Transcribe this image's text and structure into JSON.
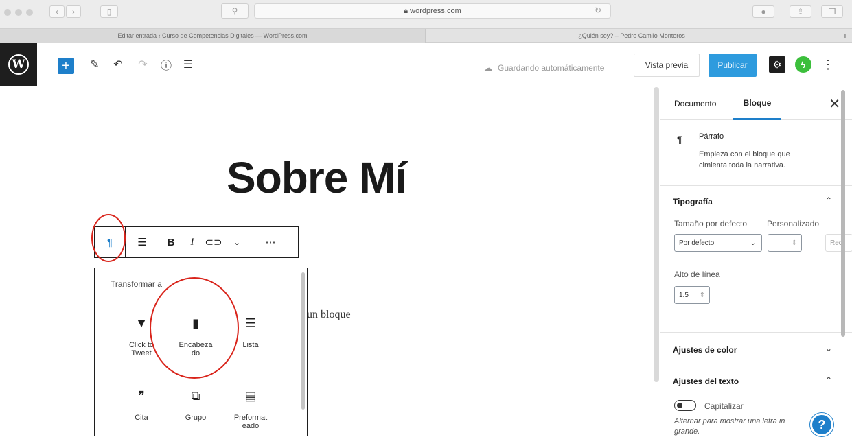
{
  "browser": {
    "url": "wordpress.com",
    "tabs": [
      {
        "label": "Editar entrada ‹ Curso de Competencias Digitales — WordPress.com"
      },
      {
        "label": "¿Quién soy? – Pedro Camilo Monteros"
      }
    ],
    "new_tab": "+"
  },
  "toolbar": {
    "wp_logo": "W",
    "add_label": "+",
    "saving_text": "Guardando automáticamente",
    "preview_label": "Vista previa",
    "publish_label": "Publicar",
    "kebab": "⋮"
  },
  "editor": {
    "title": "Sobre Mí",
    "paragraph_fragment": "un bloque",
    "block_toolbar": {
      "paragraph_icon": "¶",
      "bold": "B",
      "italic": "I",
      "more": "⋯"
    },
    "transform": {
      "label": "Transformar a",
      "items": [
        {
          "icon": "bird-icon",
          "glyph": "🐦",
          "label_lines": [
            "Click to",
            "Tweet"
          ]
        },
        {
          "icon": "bookmark-icon",
          "glyph": "■",
          "label_lines": [
            "Encabeza",
            "do"
          ]
        },
        {
          "icon": "list-icon",
          "glyph": "☰",
          "label_lines": [
            "Lista"
          ]
        },
        {
          "icon": "quote-icon",
          "glyph": "❞",
          "label_lines": [
            "Cita"
          ]
        },
        {
          "icon": "group-icon",
          "glyph": "⧉",
          "label_lines": [
            "Grupo"
          ]
        },
        {
          "icon": "preformatted-icon",
          "glyph": "▤",
          "label_lines": [
            "Preformat",
            "eado"
          ]
        }
      ]
    }
  },
  "sidebar": {
    "tab_document": "Documento",
    "tab_block": "Bloque",
    "close": "✕",
    "block": {
      "icon": "¶",
      "name": "Párrafo",
      "description_lines": [
        "Empieza con el bloque que",
        "cimienta toda la narrativa."
      ]
    },
    "typography": {
      "title": "Tipografía",
      "size_label": "Tamaño por defecto",
      "custom_label": "Personalizado",
      "size_value": "Por defecto",
      "reset_fragment": "Rec",
      "line_height_label": "Alto de línea",
      "line_height_value": "1.5"
    },
    "color": {
      "title": "Ajustes de color"
    },
    "text": {
      "title": "Ajustes del texto",
      "capitalize_label": "Capitalizar",
      "hint_lines": [
        "Alternar para mostrar una letra in",
        "grande."
      ]
    }
  },
  "help": "?",
  "colors": {
    "accent": "#1e7fca",
    "annotation": "#d9241b",
    "dark": "#1e1e1e"
  }
}
